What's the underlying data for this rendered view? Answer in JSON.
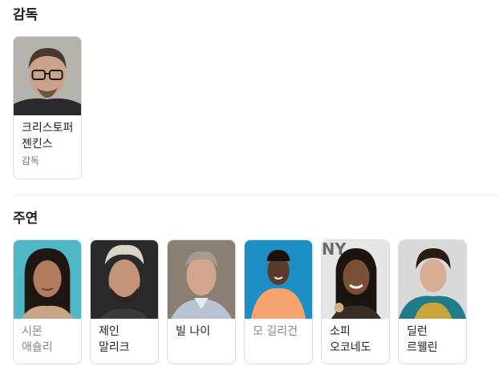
{
  "director_section": {
    "title": "감독",
    "people": [
      {
        "name": "크리스토퍼 젠킨스",
        "role": "감독"
      }
    ]
  },
  "cast_section": {
    "title": "주연",
    "people": [
      {
        "name": "시몬 애슐리"
      },
      {
        "name": "제인 말리크"
      },
      {
        "name": "빌 나이"
      },
      {
        "name": "모 길리건"
      },
      {
        "name": "소피 오코네도"
      },
      {
        "name": "딜런 르웰린"
      }
    ]
  }
}
